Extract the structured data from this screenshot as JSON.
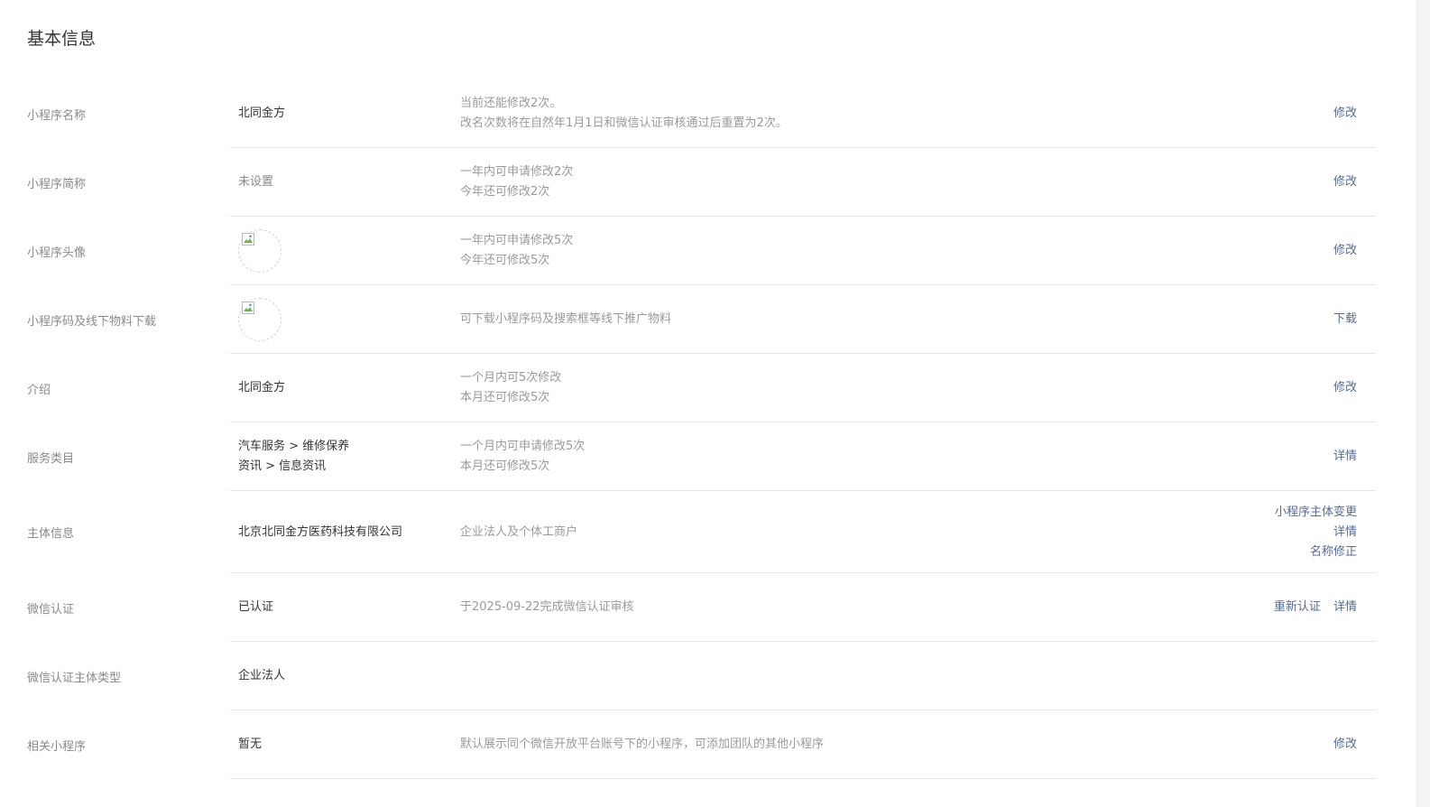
{
  "section_title": "基本信息",
  "rows": [
    {
      "label": "小程序名称",
      "value": "北同金方",
      "desc": [
        "当前还能修改2次。",
        "改名次数将在自然年1月1日和微信认证审核通过后重置为2次。"
      ],
      "actions": [
        "修改"
      ]
    },
    {
      "label": "小程序简称",
      "value": "未设置",
      "desc": [
        "一年内可申请修改2次",
        "今年还可修改2次"
      ],
      "actions": [
        "修改"
      ]
    },
    {
      "label": "小程序头像",
      "value_icon": "broken-image-icon",
      "desc": [
        "一年内可申请修改5次",
        "今年还可修改5次"
      ],
      "actions": [
        "修改"
      ]
    },
    {
      "label": "小程序码及线下物料下载",
      "value_icon": "broken-image-icon",
      "desc": [
        "可下载小程序码及搜索框等线下推广物料"
      ],
      "actions": [
        "下载"
      ]
    },
    {
      "label": "介绍",
      "value": "北同金方",
      "desc": [
        "一个月内可5次修改",
        "本月还可修改5次"
      ],
      "actions": [
        "修改"
      ]
    },
    {
      "label": "服务类目",
      "value_lines": [
        "汽车服务 > 维修保养",
        "资讯 > 信息资讯"
      ],
      "desc": [
        "一个月内可申请修改5次",
        "本月还可修改5次"
      ],
      "actions": [
        "详情"
      ]
    },
    {
      "label": "主体信息",
      "value": "北京北同金方医药科技有限公司",
      "desc": [
        "企业法人及个体工商户"
      ],
      "actions": [
        "小程序主体变更",
        "详情",
        "名称修正"
      ]
    },
    {
      "label": "微信认证",
      "value": "已认证",
      "desc": [
        "于2025-09-22完成微信认证审核"
      ],
      "actions": [
        "重新认证",
        "详情"
      ]
    },
    {
      "label": "微信认证主体类型",
      "value": "企业法人",
      "desc": [],
      "actions": []
    },
    {
      "label": "相关小程序",
      "value": "暂无",
      "desc": [
        "默认展示同个微信开放平台账号下的小程序，可添加团队的其他小程序"
      ],
      "actions": [
        "修改"
      ]
    }
  ],
  "colors": {
    "link": "#576b95",
    "label": "#8a8a8a",
    "value": "#353535",
    "divider": "#e7e7eb"
  }
}
